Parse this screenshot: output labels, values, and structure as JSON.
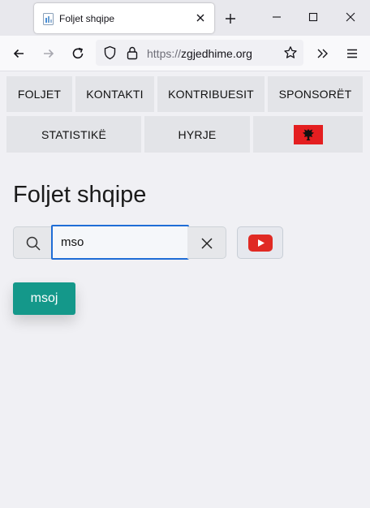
{
  "browser": {
    "tab_title": "Foljet shqipe",
    "url_scheme": "https://",
    "url_host": "zgjedhime.org",
    "icons": [
      "page-favicon",
      "close-tab-icon",
      "new-tab-icon",
      "minimize-icon",
      "maximize-icon",
      "close-window-icon",
      "back-icon",
      "forward-icon",
      "reload-icon",
      "shield-icon",
      "lock-icon",
      "bookmark-star-icon",
      "overflow-chevrons-icon",
      "hamburger-menu-icon"
    ]
  },
  "nav": {
    "row1": [
      "FOLJET",
      "KONTAKTI",
      "KONTRIBUESIT",
      "SPONSORËT"
    ],
    "row2": [
      "STATISTIKË",
      "HYRJE"
    ],
    "language_flag": "albania-flag-icon"
  },
  "main": {
    "title": "Foljet shqipe",
    "search": {
      "value": "mso",
      "icons": [
        "search-icon",
        "clear-icon",
        "youtube-icon"
      ]
    },
    "results": [
      "msoj"
    ]
  },
  "colors": {
    "accent": "#14988a",
    "input_focus": "#1f6dd6",
    "youtube_red": "#e02a24",
    "flag_red": "#e41e20",
    "button_bg": "#e3e4e8",
    "page_bg": "#f0f0f4"
  }
}
